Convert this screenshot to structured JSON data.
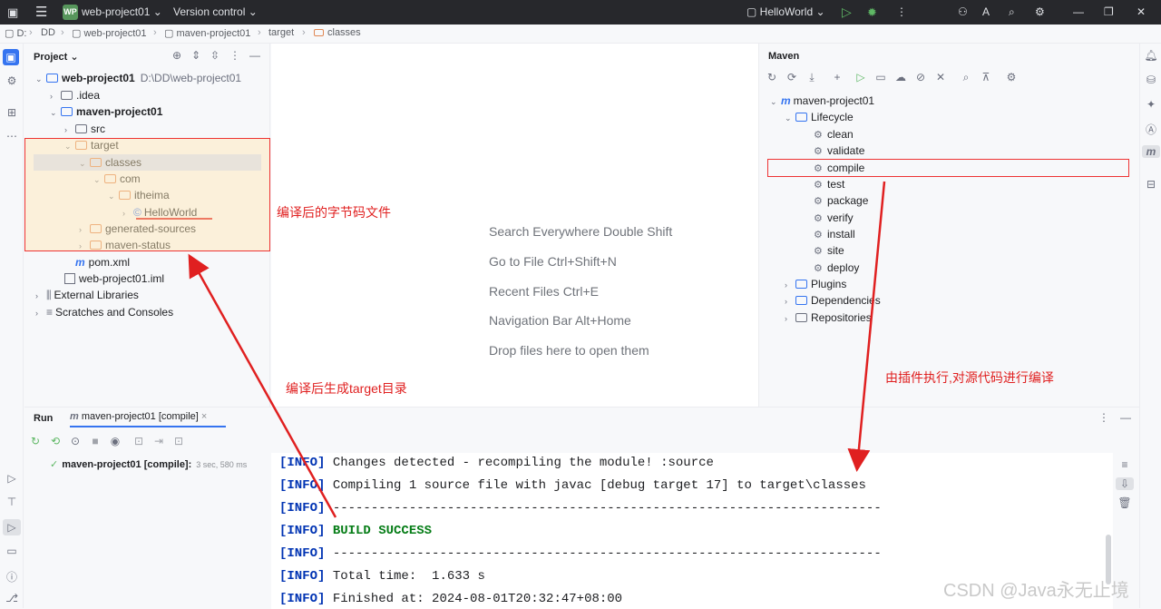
{
  "titlebar": {
    "project_badge": "WP",
    "project_name": "web-project01",
    "vcs": "Version control",
    "run_config": "HelloWorld"
  },
  "breadcrumb": [
    "D:",
    "DD",
    "web-project01",
    "maven-project01",
    "target",
    "classes"
  ],
  "project_panel": {
    "title": "Project",
    "tree": [
      {
        "label": "web-project01",
        "extra": "D:\\DD\\web-project01",
        "bold": true
      },
      {
        "label": ".idea"
      },
      {
        "label": "maven-project01",
        "bold": true
      },
      {
        "label": "src"
      },
      {
        "label": "target"
      },
      {
        "label": "classes"
      },
      {
        "label": "com"
      },
      {
        "label": "itheima"
      },
      {
        "label": "HelloWorld"
      },
      {
        "label": "generated-sources"
      },
      {
        "label": "maven-status"
      },
      {
        "label": "pom.xml"
      },
      {
        "label": "web-project01.iml"
      },
      {
        "label": "External Libraries"
      },
      {
        "label": "Scratches and Consoles"
      }
    ]
  },
  "editor_hints": [
    "Search Everywhere Double Shift",
    "Go to File Ctrl+Shift+N",
    "Recent Files Ctrl+E",
    "Navigation Bar Alt+Home",
    "Drop files here to open them"
  ],
  "maven_panel": {
    "title": "Maven",
    "project": "maven-project01",
    "lifecycle": "Lifecycle",
    "phases": [
      "clean",
      "validate",
      "compile",
      "test",
      "package",
      "verify",
      "install",
      "site",
      "deploy"
    ],
    "groups": [
      "Plugins",
      "Dependencies",
      "Repositories"
    ]
  },
  "run_panel": {
    "title": "Run",
    "tab": "maven-project01 [compile]",
    "tree_item": "maven-project01 [compile]:",
    "tree_time": "3 sec, 580 ms",
    "console": [
      {
        "tag": "[INFO]",
        "text": " Changes detected - recompiling the module! :source"
      },
      {
        "tag": "[INFO]",
        "text": " Compiling 1 source file with javac [debug target 17] to target\\classes"
      },
      {
        "tag": "[INFO]",
        "text": " ------------------------------------------------------------------------"
      },
      {
        "tag": "[INFO]",
        "text": " BUILD SUCCESS"
      },
      {
        "tag": "[INFO]",
        "text": " ------------------------------------------------------------------------"
      },
      {
        "tag": "[INFO]",
        "text": " Total time:  1.633 s"
      },
      {
        "tag": "[INFO]",
        "text": " Finished at: 2024-08-01T20:32:47+08:00"
      }
    ]
  },
  "annotations": {
    "bytecode": "编译后的字节码文件",
    "target_dir": "编译后生成target目录",
    "plugin": "由插件执行,对源代码进行编译"
  },
  "watermark": "CSDN @Java永无止境",
  "colors": {
    "annotation_red": "#e02020",
    "success_green": "#067d17",
    "info_blue": "#0033b3"
  }
}
